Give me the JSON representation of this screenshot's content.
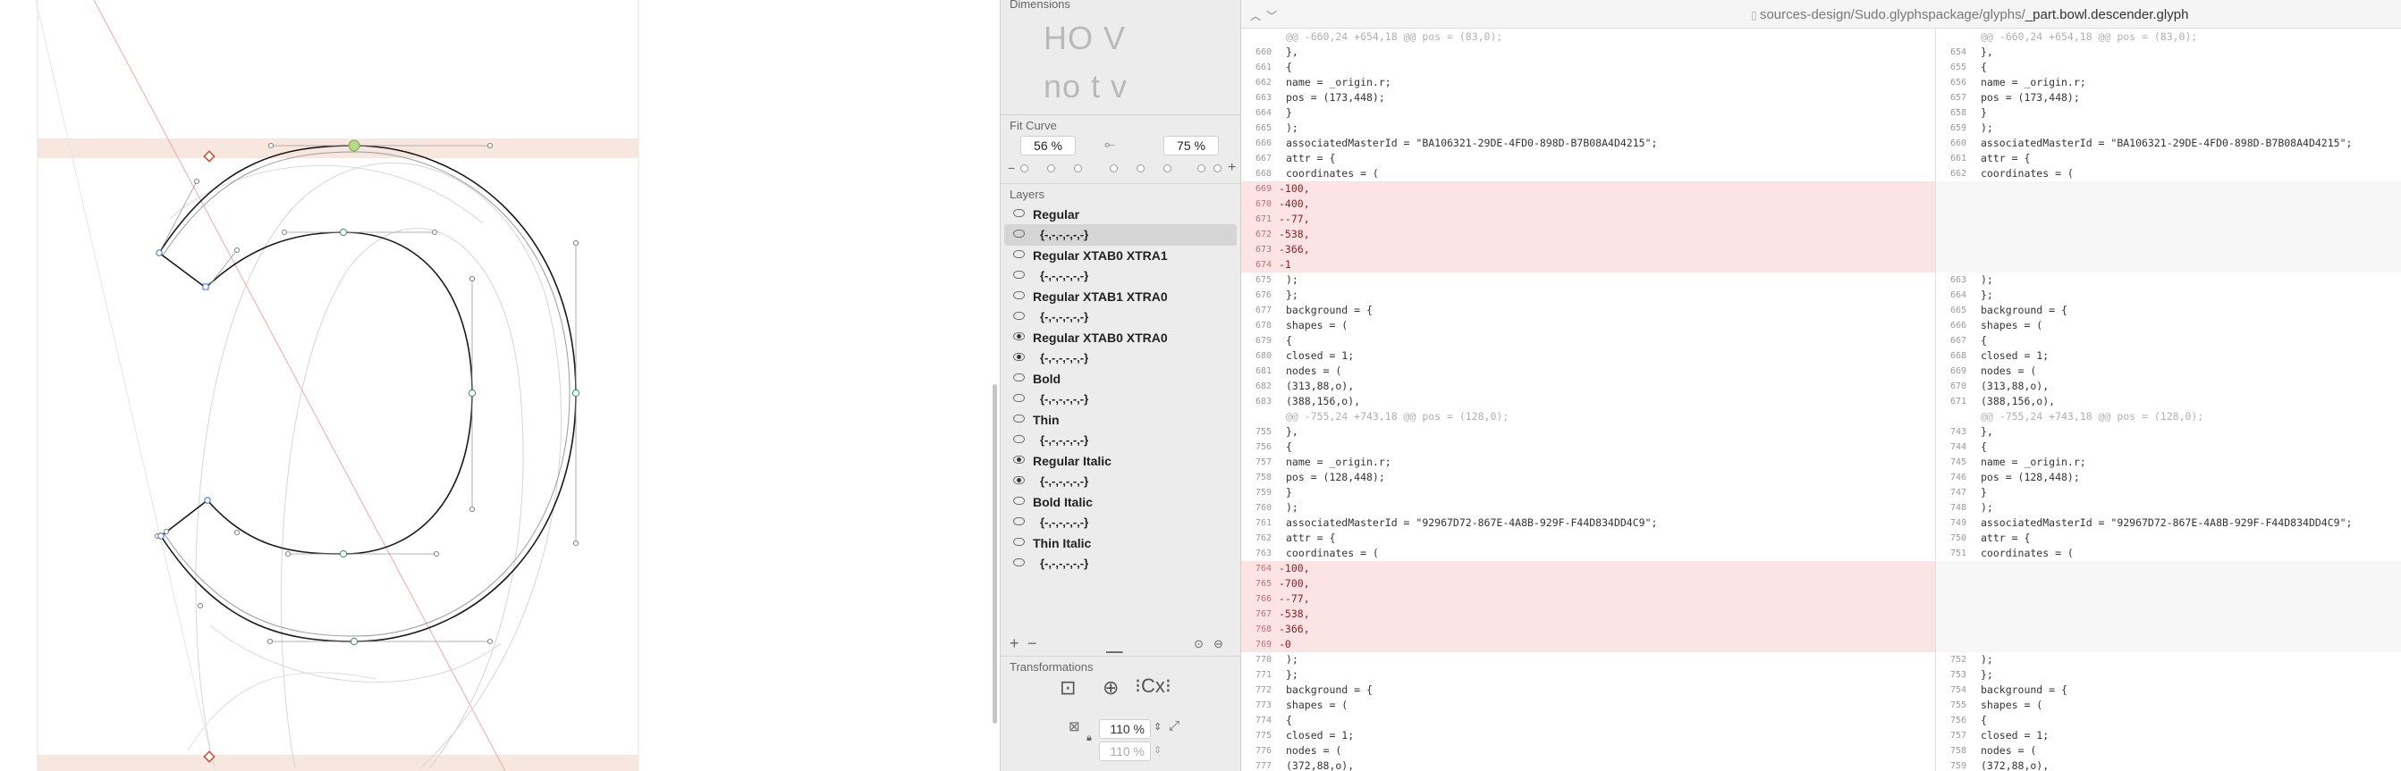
{
  "inspector": {
    "dimensions_title": "Dimensions",
    "preview_top": "HO V",
    "preview_bottom": "no t v",
    "fit_curve_title": "Fit Curve",
    "fit_left": "56 %",
    "fit_right": "75 %",
    "layers_title": "Layers",
    "layers": [
      {
        "name": "Regular",
        "coords": "{-,-,-,-,-,-}",
        "visible": false
      },
      {
        "name": "Regular XTAB0 XTRA1",
        "coords": "{-,-,-,-,-,-}",
        "visible": false
      },
      {
        "name": "Regular XTAB1 XTRA0",
        "coords": "{-,-,-,-,-,-}",
        "visible": false
      },
      {
        "name": "Regular XTAB0 XTRA0",
        "coords": "{-,-,-,-,-,-}",
        "visible": true
      },
      {
        "name": "Bold",
        "coords": "{-,-,-,-,-,-}",
        "visible": false
      },
      {
        "name": "Thin",
        "coords": "{-,-,-,-,-,-}",
        "visible": false
      },
      {
        "name": "Regular Italic",
        "coords": "{-,-,-,-,-,-}",
        "visible": true
      },
      {
        "name": "Bold Italic",
        "coords": "{-,-,-,-,-,-}",
        "visible": false
      },
      {
        "name": "Thin Italic",
        "coords": "{-,-,-,-,-,-}",
        "visible": false
      }
    ],
    "transformations_title": "Transformations",
    "scale_x": "110 %",
    "scale_y": "110 %"
  },
  "diff": {
    "path_prefix": "sources-design/Sudo.glyphspackage/glyphs/",
    "path_leaf": "_part.bowl.descender.glyph",
    "left": [
      {
        "n": "",
        "t": "@@ -660,24 +654,18 @@ pos = (83,0);",
        "k": "hunk"
      },
      {
        "n": "660",
        "t": "},",
        "k": ""
      },
      {
        "n": "661",
        "t": "{",
        "k": ""
      },
      {
        "n": "662",
        "t": "name = _origin.r;",
        "k": ""
      },
      {
        "n": "663",
        "t": "pos = (173,448);",
        "k": ""
      },
      {
        "n": "664",
        "t": "}",
        "k": ""
      },
      {
        "n": "665",
        "t": ");",
        "k": ""
      },
      {
        "n": "666",
        "t": "associatedMasterId = \"BA106321-29DE-4FD0-898D-B7B08A4D4215\";",
        "k": ""
      },
      {
        "n": "667",
        "t": "attr = {",
        "k": ""
      },
      {
        "n": "668",
        "t": "coordinates = (",
        "k": ""
      },
      {
        "n": "669",
        "t": "100,",
        "k": "del"
      },
      {
        "n": "670",
        "t": "400,",
        "k": "del"
      },
      {
        "n": "671",
        "t": "-77,",
        "k": "del"
      },
      {
        "n": "672",
        "t": "538,",
        "k": "del"
      },
      {
        "n": "673",
        "t": "366,",
        "k": "del"
      },
      {
        "n": "674",
        "t": "1",
        "k": "del"
      },
      {
        "n": "675",
        "t": ");",
        "k": ""
      },
      {
        "n": "676",
        "t": "};",
        "k": ""
      },
      {
        "n": "677",
        "t": "background = {",
        "k": ""
      },
      {
        "n": "678",
        "t": "shapes = (",
        "k": ""
      },
      {
        "n": "679",
        "t": "{",
        "k": ""
      },
      {
        "n": "680",
        "t": "closed = 1;",
        "k": ""
      },
      {
        "n": "681",
        "t": "nodes = (",
        "k": ""
      },
      {
        "n": "682",
        "t": "(313,88,o),",
        "k": ""
      },
      {
        "n": "683",
        "t": "(388,156,o),",
        "k": ""
      },
      {
        "n": "",
        "t": "@@ -755,24 +743,18 @@ pos = (128,0);",
        "k": "hunk"
      },
      {
        "n": "755",
        "t": "},",
        "k": ""
      },
      {
        "n": "756",
        "t": "{",
        "k": ""
      },
      {
        "n": "757",
        "t": "name = _origin.r;",
        "k": ""
      },
      {
        "n": "758",
        "t": "pos = (128,448);",
        "k": ""
      },
      {
        "n": "759",
        "t": "}",
        "k": ""
      },
      {
        "n": "760",
        "t": ");",
        "k": ""
      },
      {
        "n": "761",
        "t": "associatedMasterId = \"92967D72-867E-4A8B-929F-F44D834DD4C9\";",
        "k": ""
      },
      {
        "n": "762",
        "t": "attr = {",
        "k": ""
      },
      {
        "n": "763",
        "t": "coordinates = (",
        "k": ""
      },
      {
        "n": "764",
        "t": "100,",
        "k": "del"
      },
      {
        "n": "765",
        "t": "700,",
        "k": "del"
      },
      {
        "n": "766",
        "t": "-77,",
        "k": "del"
      },
      {
        "n": "767",
        "t": "538,",
        "k": "del"
      },
      {
        "n": "768",
        "t": "366,",
        "k": "del"
      },
      {
        "n": "769",
        "t": "0",
        "k": "del"
      },
      {
        "n": "770",
        "t": ");",
        "k": ""
      },
      {
        "n": "771",
        "t": "};",
        "k": ""
      },
      {
        "n": "772",
        "t": "background = {",
        "k": ""
      },
      {
        "n": "773",
        "t": "shapes = (",
        "k": ""
      },
      {
        "n": "774",
        "t": "{",
        "k": ""
      },
      {
        "n": "775",
        "t": "closed = 1;",
        "k": ""
      },
      {
        "n": "776",
        "t": "nodes = (",
        "k": ""
      },
      {
        "n": "777",
        "t": "(372,88,o),",
        "k": ""
      }
    ],
    "right": [
      {
        "n": "",
        "t": "@@ -660,24 +654,18 @@ pos = (83,0);",
        "k": "hunk"
      },
      {
        "n": "654",
        "t": "},",
        "k": ""
      },
      {
        "n": "655",
        "t": "{",
        "k": ""
      },
      {
        "n": "656",
        "t": "name = _origin.r;",
        "k": ""
      },
      {
        "n": "657",
        "t": "pos = (173,448);",
        "k": ""
      },
      {
        "n": "658",
        "t": "}",
        "k": ""
      },
      {
        "n": "659",
        "t": ");",
        "k": ""
      },
      {
        "n": "660",
        "t": "associatedMasterId = \"BA106321-29DE-4FD0-898D-B7B08A4D4215\";",
        "k": ""
      },
      {
        "n": "661",
        "t": "attr = {",
        "k": ""
      },
      {
        "n": "662",
        "t": "coordinates = (",
        "k": ""
      },
      {
        "n": "",
        "t": "",
        "k": "gap"
      },
      {
        "n": "",
        "t": "",
        "k": "gap"
      },
      {
        "n": "",
        "t": "",
        "k": "gap"
      },
      {
        "n": "",
        "t": "",
        "k": "gap"
      },
      {
        "n": "",
        "t": "",
        "k": "gap"
      },
      {
        "n": "",
        "t": "",
        "k": "gap"
      },
      {
        "n": "663",
        "t": ");",
        "k": ""
      },
      {
        "n": "664",
        "t": "};",
        "k": ""
      },
      {
        "n": "665",
        "t": "background = {",
        "k": ""
      },
      {
        "n": "666",
        "t": "shapes = (",
        "k": ""
      },
      {
        "n": "667",
        "t": "{",
        "k": ""
      },
      {
        "n": "668",
        "t": "closed = 1;",
        "k": ""
      },
      {
        "n": "669",
        "t": "nodes = (",
        "k": ""
      },
      {
        "n": "670",
        "t": "(313,88,o),",
        "k": ""
      },
      {
        "n": "671",
        "t": "(388,156,o),",
        "k": ""
      },
      {
        "n": "",
        "t": "@@ -755,24 +743,18 @@ pos = (128,0);",
        "k": "hunk"
      },
      {
        "n": "743",
        "t": "},",
        "k": ""
      },
      {
        "n": "744",
        "t": "{",
        "k": ""
      },
      {
        "n": "745",
        "t": "name = _origin.r;",
        "k": ""
      },
      {
        "n": "746",
        "t": "pos = (128,448);",
        "k": ""
      },
      {
        "n": "747",
        "t": "}",
        "k": ""
      },
      {
        "n": "748",
        "t": ");",
        "k": ""
      },
      {
        "n": "749",
        "t": "associatedMasterId = \"92967D72-867E-4A8B-929F-F44D834DD4C9\";",
        "k": ""
      },
      {
        "n": "750",
        "t": "attr = {",
        "k": ""
      },
      {
        "n": "751",
        "t": "coordinates = (",
        "k": ""
      },
      {
        "n": "",
        "t": "",
        "k": "gap"
      },
      {
        "n": "",
        "t": "",
        "k": "gap"
      },
      {
        "n": "",
        "t": "",
        "k": "gap"
      },
      {
        "n": "",
        "t": "",
        "k": "gap"
      },
      {
        "n": "",
        "t": "",
        "k": "gap"
      },
      {
        "n": "",
        "t": "",
        "k": "gap"
      },
      {
        "n": "752",
        "t": ");",
        "k": ""
      },
      {
        "n": "753",
        "t": "};",
        "k": ""
      },
      {
        "n": "754",
        "t": "background = {",
        "k": ""
      },
      {
        "n": "755",
        "t": "shapes = (",
        "k": ""
      },
      {
        "n": "756",
        "t": "{",
        "k": ""
      },
      {
        "n": "757",
        "t": "closed = 1;",
        "k": ""
      },
      {
        "n": "758",
        "t": "nodes = (",
        "k": ""
      },
      {
        "n": "759",
        "t": "(372,88,o),",
        "k": ""
      }
    ]
  }
}
